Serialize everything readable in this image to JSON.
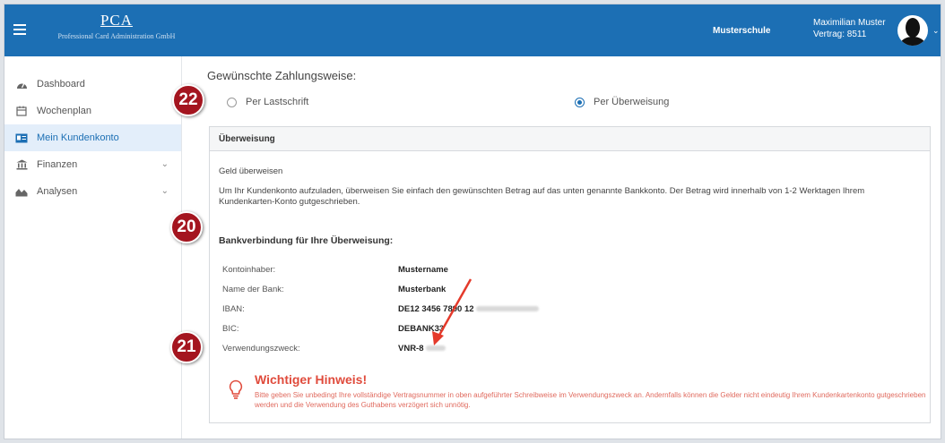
{
  "header": {
    "logo_main": "PCA",
    "logo_sub": "Professional Card Administration GmbH",
    "school": "Musterschule",
    "user_name": "Maximilian Muster",
    "contract": "Vertrag: 8511"
  },
  "sidebar": {
    "items": [
      {
        "label": "Dashboard",
        "icon": "dashboard-icon"
      },
      {
        "label": "Wochenplan",
        "icon": "calendar-icon"
      },
      {
        "label": "Mein Kundenkonto",
        "icon": "id-card-icon"
      },
      {
        "label": "Finanzen",
        "icon": "bank-icon"
      },
      {
        "label": "Analysen",
        "icon": "chart-icon"
      }
    ]
  },
  "payment": {
    "heading": "Gewünschte Zahlungsweise:",
    "option_debit": "Per Lastschrift",
    "option_transfer": "Per Überweisung",
    "selected": "Per Überweisung"
  },
  "panel": {
    "title": "Überweisung",
    "intro": "Geld überweisen",
    "description": "Um Ihr Kundenkonto aufzuladen, überweisen Sie einfach den gewünschten Betrag auf das unten genannte Bankkonto. Der Betrag wird innerhalb von 1-2 Werktagen Ihrem Kundenkarten-Konto gutgeschrieben.",
    "bank_heading": "Bankverbindung für Ihre Überweisung:",
    "rows": [
      {
        "label": "Kontoinhaber:",
        "value": "Mustername"
      },
      {
        "label": "Name der Bank:",
        "value": "Musterbank"
      },
      {
        "label": "IBAN:",
        "value": "DE12 3456 7890 12"
      },
      {
        "label": "BIC:",
        "value": "DEBANK33"
      },
      {
        "label": "Verwendungszweck:",
        "value": "VNR-8"
      }
    ],
    "hint_title": "Wichtiger Hinweis!",
    "hint_text": "Bitte geben Sie unbedingt Ihre vollständige Vertragsnummer in oben aufgeführter Schreibweise im Verwendungszweck an. Andernfalls können die Gelder nicht eindeutig Ihrem Kundenkartenkonto gutgeschrieben werden und die Verwendung des Guthabens verzögert sich unnötig."
  },
  "badges": [
    "22",
    "20",
    "21"
  ],
  "colors": {
    "topbar": "#1c6fb4",
    "accent": "#1c6fb4",
    "badge": "#a4151f",
    "hint": "#e04b3c"
  }
}
